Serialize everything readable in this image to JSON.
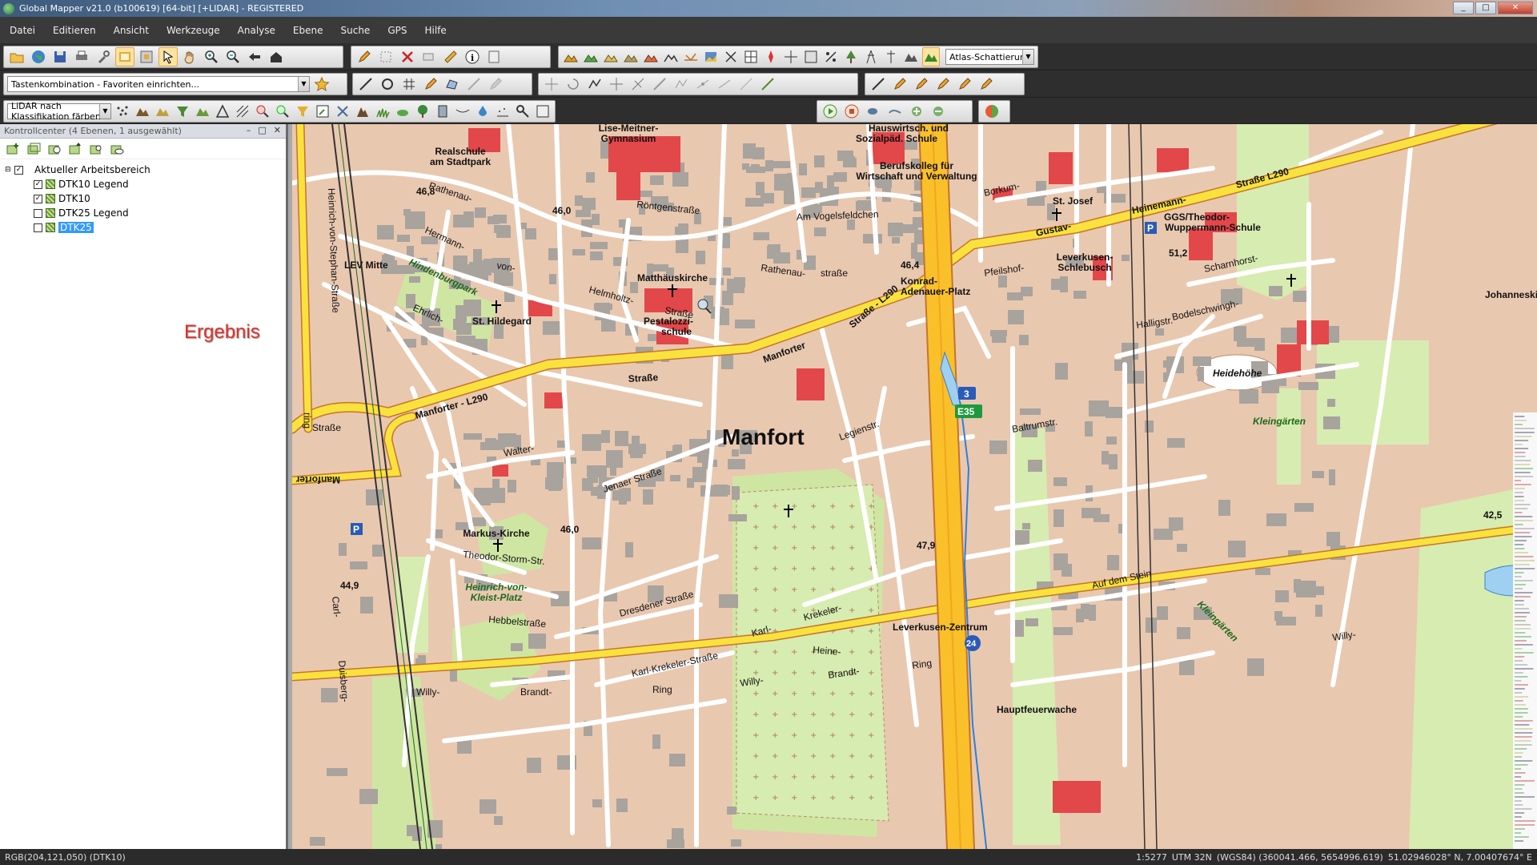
{
  "window": {
    "title": "Global Mapper v21.0 (b100619) [64-bit] [+LIDAR] - REGISTERED",
    "controls": [
      "_",
      "□",
      "✕"
    ]
  },
  "menu": [
    "Datei",
    "Editieren",
    "Ansicht",
    "Werkzeuge",
    "Analyse",
    "Ebene",
    "Suche",
    "GPS",
    "Hilfe"
  ],
  "toolbar": {
    "shader_combo": "Atlas-Schattierung",
    "favorites_combo": "Tastenkombination - Favoriten einrichten...",
    "lidar_combo": "LiDAR nach Klassifikation färben"
  },
  "panel": {
    "title": "Kontrollcenter (4 Ebenen, 1 ausgewählt)",
    "workspace": "Aktueller Arbeitsbereich",
    "layers": [
      {
        "name": "DTK10 Legend",
        "checked": true,
        "selected": false
      },
      {
        "name": "DTK10",
        "checked": true,
        "selected": false
      },
      {
        "name": "DTK25 Legend",
        "checked": false,
        "selected": false
      },
      {
        "name": "DTK25",
        "checked": false,
        "selected": true
      }
    ],
    "annotation": "Ergebnis"
  },
  "map": {
    "district": "Manfort",
    "labels": {
      "lise": "Lise-Meitner-",
      "gymnasium": "Gymnasium",
      "hauswirtsch": "Hauswirtsch. und",
      "sozialpad": "Sozialpäd. Schule",
      "realschule": "Realschule",
      "stadtpark": "am Stadtpark",
      "berufskolleg": "Berufskolleg für",
      "wirtschaft": "Wirtschaft und Verwaltung",
      "rathenau1": "Rathenau-",
      "rathenau2": "Rathenau-",
      "strasse_rathenau": "straße",
      "roentgen": "Röntgenstraße",
      "vogelsfeld": "Am Vogelsfeldchen",
      "borkum": "Borkum-",
      "stjosef": "St. Josef",
      "heinemann": "Heinemann-",
      "strasse_l290": "Straße L290",
      "gustav": "Gustav-",
      "ggs1": "GGS/Theodor-",
      "ggs2": "Wuppermann-Schule",
      "leverkusen_schlebusch1": "Leverkusen-",
      "leverkusen_schlebusch2": "Schlebusch",
      "pfeilshof": "Pfeilshof-",
      "scharnhorst": "Scharnhorst-",
      "johanneskirche": "Johanneskirche",
      "bodelschwingh": "Bodelschwingh-",
      "hindenburgpark": "Hindenburgpark",
      "hermann": "Hermann-",
      "von": "von-",
      "helmholtz": "Helmholtz-",
      "strasse_helm": "Straße",
      "matthaeus": "Matthäuskirche",
      "pestalozzi1": "Pestalozzi-",
      "pestalozzi2": "schule",
      "konrad1": "Konrad-",
      "konrad2": "Adenauer-Platz",
      "levmitte": "LEV Mitte",
      "sthildegard": "St. Hildegard",
      "ehrlich": "Ehrlich-",
      "manforter1": "Manforter",
      "manforter_strasse": "Straße",
      "manforter_l290": "Manforter - L290",
      "manforter_bottom": "Manforter",
      "strasse_l290b": "Straße - L290",
      "heidehoehe": "Heidehöhe",
      "hallig": "Halligstr.",
      "kleingaerten": "Kleingärten",
      "kleingaerten2": "Kleingärten",
      "baltrum": "Baltrumstr.",
      "legien": "Legienstr.",
      "jenaer": "Jenaer Straße",
      "walter": "Walter-",
      "markus": "Markus-Kirche",
      "theodor": "Theodor-Storm-Str.",
      "heinrich1": "Heinrich-von-",
      "heinrich2": "Kleist-Platz",
      "hebbel": "Hebbelstraße",
      "dresdener": "Dresdener Straße",
      "karl": "Karl-",
      "krekeler": "Krekeler-",
      "karlkrekeler": "Karl-Krekeler-Straße",
      "leverkusen_zentrum": "Leverkusen-Zentrum",
      "willy": "Willy-",
      "brandt": "Brandt-",
      "ring": "Ring",
      "willy2": "Willy-",
      "brandt2": "Brandt-",
      "ring2": "Ring",
      "willy3": "Willy-",
      "hauptfeuerwache": "Hauptfeuerwache",
      "aufdemstein": "Auf dem Stein",
      "heine": "Heine-",
      "heinrich_stephan": "Heinrich-von-Stephan-Straße",
      "carl": "Carl-",
      "duisberg": "Duisberg-",
      "ring_left": "ring",
      "strasse_left": "Straße",
      "e35": "E35",
      "a3": "3",
      "n24": "24",
      "elev_468": "46,8",
      "elev_460a": "46,0",
      "elev_464": "46,4",
      "elev_512": "51,2",
      "elev_460b": "46,0",
      "elev_479": "47,9",
      "elev_449": "44,9",
      "elev_425": "42,5",
      "parking": "P"
    }
  },
  "status": {
    "left": "RGB(204,121,050) (DTK10)",
    "scale": "1:5277",
    "projection": "UTM 32N",
    "coords": "(WGS84) (360041.466, 5654996.619)",
    "latlon": "51.02946028° N, 7.00407674° E"
  }
}
